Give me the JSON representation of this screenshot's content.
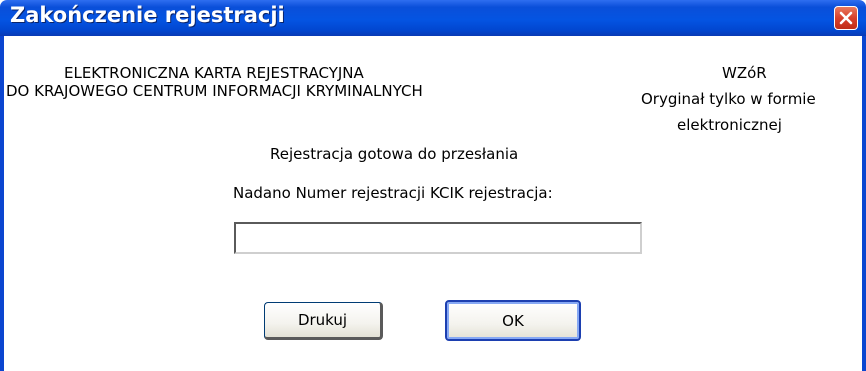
{
  "window": {
    "title": "Zakończenie rejestracji",
    "close_icon": "close-icon"
  },
  "header": {
    "left_line1": "ELEKTRONICZNA KARTA REJESTRACYJNA",
    "left_line2": "DO KRAJOWEGO CENTRUM INFORMACJI KRYMINALNYCH",
    "right_line1": "WZóR",
    "right_line2": "Oryginał tylko w formie",
    "right_line3": "elektronicznej"
  },
  "body": {
    "status": "Rejestracja gotowa do przesłania",
    "prompt": "Nadano Numer rejestracji KCIK rejestracja:",
    "registration_number": ""
  },
  "buttons": {
    "print_label": "Drukuj",
    "ok_label": "OK"
  },
  "colors": {
    "titlebar": "#0454e2",
    "close": "#d8412c"
  }
}
